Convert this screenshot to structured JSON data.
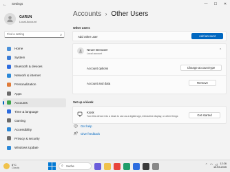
{
  "window": {
    "title": "Settings",
    "back_icon": "back-arrow-icon",
    "controls": [
      "minimize",
      "maximize",
      "close"
    ]
  },
  "profile": {
    "name": "GARUN",
    "subtitle": "Local Account"
  },
  "search": {
    "placeholder": "Find a setting"
  },
  "nav": {
    "items": [
      {
        "label": "Home",
        "color": "#4a90d9"
      },
      {
        "label": "System",
        "color": "#3a7bd5"
      },
      {
        "label": "Bluetooth & devices",
        "color": "#2d6cdf"
      },
      {
        "label": "Network & internet",
        "color": "#2b88d8"
      },
      {
        "label": "Personalization",
        "color": "#e07b39"
      },
      {
        "label": "Apps",
        "color": "#6b6b6b"
      },
      {
        "label": "Accounts",
        "color": "#3fa34d",
        "active": true
      },
      {
        "label": "Time & language",
        "color": "#2d6cdf"
      },
      {
        "label": "Gaming",
        "color": "#6b6b6b"
      },
      {
        "label": "Accessibility",
        "color": "#2b88d8"
      },
      {
        "label": "Privacy & security",
        "color": "#6b6b6b"
      },
      {
        "label": "Windows Update",
        "color": "#2b88d8"
      }
    ]
  },
  "breadcrumb": {
    "parent": "Accounts",
    "separator": "›",
    "current": "Other Users"
  },
  "other_users": {
    "section_label": "Other users",
    "add_label": "Add other user",
    "add_button": "Add account",
    "user": {
      "name": "Neuer Benutzer",
      "type": "Local account",
      "options_label": "Account options",
      "options_button": "Change account type",
      "data_label": "Account and data",
      "data_button": "Remove"
    }
  },
  "kiosk": {
    "section_label": "Set up a kiosk",
    "title": "Kiosk",
    "description": "Turn this device into a kiosk to use as a digital sign, interactive display, or other things",
    "button": "Get started"
  },
  "links": {
    "help": "Get help",
    "feedback": "Give feedback"
  },
  "taskbar": {
    "weather_temp": "8°C",
    "weather_cond": "Cloudy",
    "search_label": "Suche",
    "time": "12:26",
    "date": "15.03.2025",
    "accent": "#0078d4"
  }
}
